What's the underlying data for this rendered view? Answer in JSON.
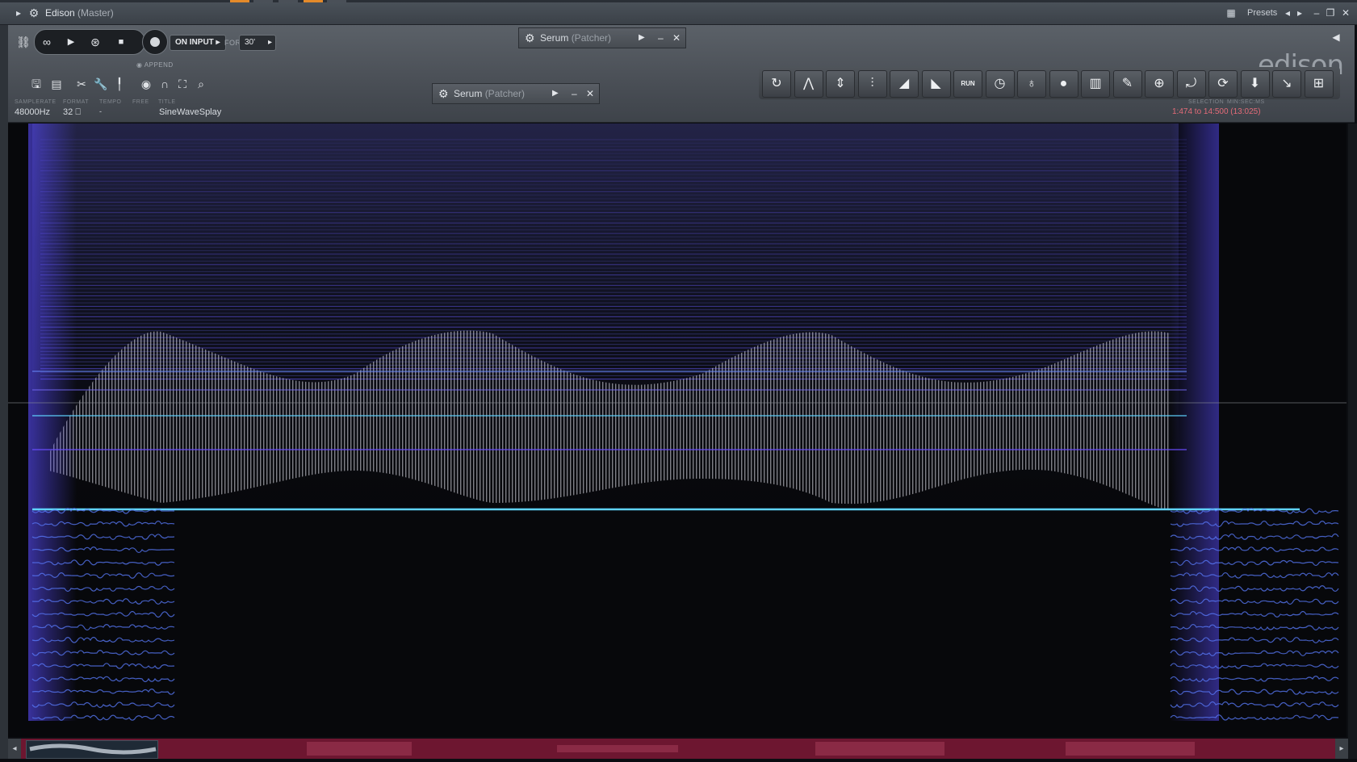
{
  "window": {
    "title": "Edison",
    "title_sub": "(Master)",
    "presets_label": "Presets"
  },
  "transport": {
    "mode": "ON INPUT",
    "for_label": "FOR",
    "duration": "30'",
    "append_label": "APPEND"
  },
  "logo": "edison",
  "info": {
    "samplerate_caption": "SAMPLERATE",
    "samplerate": "48000Hz",
    "format_caption": "FORMAT",
    "format": "32",
    "tempo_caption": "TEMPO",
    "tempo": "-",
    "free_caption": "FREE",
    "title_caption": "TITLE",
    "title": "SineWaveSplay",
    "selection_caption": "SELECTION",
    "minsecms_caption": "MIN:SEC:MS",
    "selection": "1:474 to 14:500 (13:025)"
  },
  "popups": [
    {
      "name": "Serum",
      "sub": "(Patcher)"
    },
    {
      "name": "Serum",
      "sub": "(Patcher)"
    }
  ],
  "tools_right": [
    {
      "icon": "reload-icon",
      "glyph": "↻"
    },
    {
      "icon": "pitch-fork-icon",
      "glyph": "⋀"
    },
    {
      "icon": "amplitude-icon",
      "glyph": "⇕"
    },
    {
      "icon": "eq-icon",
      "glyph": "⫶"
    },
    {
      "icon": "fade-in-icon",
      "glyph": "◢"
    },
    {
      "icon": "fade-out-icon",
      "glyph": "◣"
    },
    {
      "icon": "run-icon",
      "glyph": "RUN"
    },
    {
      "icon": "clock-icon",
      "glyph": "◷"
    },
    {
      "icon": "blur-icon",
      "glyph": "♁"
    },
    {
      "icon": "drop-icon",
      "glyph": "●"
    },
    {
      "icon": "spectrum-icon",
      "glyph": "▥"
    },
    {
      "icon": "brush-icon",
      "glyph": "✎"
    },
    {
      "icon": "marker-add-icon",
      "glyph": "⊕"
    },
    {
      "icon": "marker-icon",
      "glyph": "⤾"
    },
    {
      "icon": "convert-icon",
      "glyph": "⟳"
    },
    {
      "icon": "save-icon",
      "glyph": "⬇"
    },
    {
      "icon": "drag-icon",
      "glyph": "↘"
    },
    {
      "icon": "export-icon",
      "glyph": "⊞"
    }
  ],
  "colors": {
    "accent": "#e48a2a",
    "selection_text": "#e36b78",
    "scroll_bg": "#6d1630",
    "spectrum_cyan": "#5fd4ff",
    "spectrum_violet": "#6a4cff"
  }
}
